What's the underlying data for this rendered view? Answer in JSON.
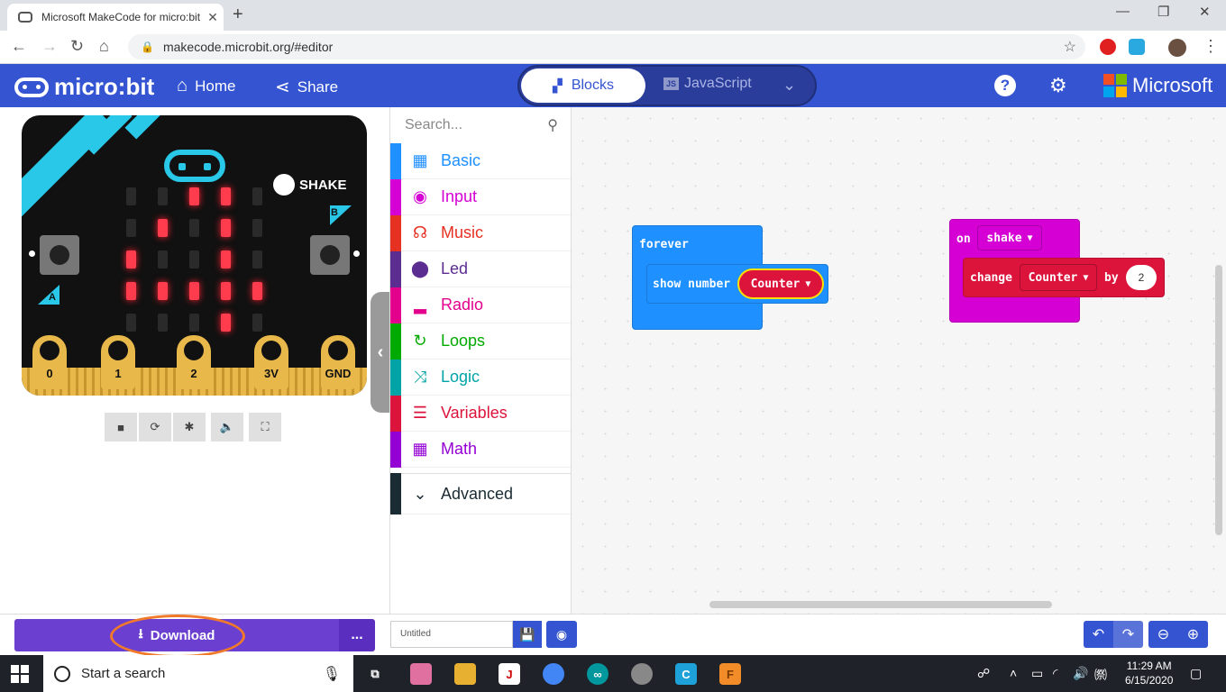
{
  "browser": {
    "tab_title": "Microsoft MakeCode for micro:bit",
    "url": "makecode.microbit.org/#editor"
  },
  "header": {
    "logo_text": "micro:bit",
    "home_label": "Home",
    "share_label": "Share",
    "blocks_label": "Blocks",
    "javascript_label": "JavaScript",
    "microsoft_label": "Microsoft"
  },
  "simulator": {
    "shake_label": "SHAKE",
    "button_a": "A",
    "button_b": "B",
    "pins": [
      "0",
      "1",
      "2",
      "3V",
      "GND"
    ],
    "led_matrix": [
      [
        0,
        0,
        1,
        1,
        0
      ],
      [
        0,
        1,
        0,
        1,
        0
      ],
      [
        1,
        0,
        0,
        1,
        0
      ],
      [
        1,
        1,
        1,
        1,
        1
      ],
      [
        0,
        0,
        0,
        1,
        0
      ]
    ]
  },
  "toolbox": {
    "search_placeholder": "Search...",
    "categories": [
      {
        "label": "Basic",
        "color": "#1e90ff",
        "icon": "grid-icon"
      },
      {
        "label": "Input",
        "color": "#d400d4",
        "icon": "target-icon"
      },
      {
        "label": "Music",
        "color": "#e63022",
        "icon": "headphones-icon"
      },
      {
        "label": "Led",
        "color": "#5c2d91",
        "icon": "toggle-icon"
      },
      {
        "label": "Radio",
        "color": "#e3008c",
        "icon": "signal-icon"
      },
      {
        "label": "Loops",
        "color": "#00aa00",
        "icon": "refresh-icon"
      },
      {
        "label": "Logic",
        "color": "#00a4a6",
        "icon": "shuffle-icon"
      },
      {
        "label": "Variables",
        "color": "#dc143c",
        "icon": "list-icon"
      },
      {
        "label": "Math",
        "color": "#9400d3",
        "icon": "calculator-icon"
      }
    ],
    "advanced_label": "Advanced"
  },
  "workspace": {
    "forever_label": "forever",
    "show_number_label": "show number",
    "counter_var": "Counter",
    "on_label": "on",
    "shake_event": "shake",
    "change_label": "change",
    "change_var": "Counter",
    "by_label": "by",
    "by_value": "2"
  },
  "bottom": {
    "download_label": "Download",
    "more_label": "...",
    "project_name": "Untitled"
  },
  "taskbar": {
    "search_placeholder": "Start a search",
    "time": "11:29 AM",
    "date": "6/15/2020"
  }
}
